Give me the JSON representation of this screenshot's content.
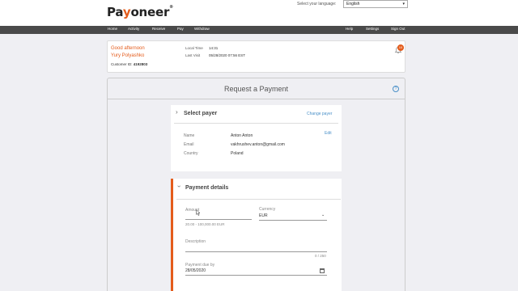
{
  "header": {
    "logo_pre": "Pa",
    "logo_y": "y",
    "logo_post": "oneer",
    "logo_tm": "®",
    "language_label": "Select your language:",
    "language_value": "English"
  },
  "nav": {
    "items": [
      "Home",
      "Activity",
      "Receive",
      "Pay",
      "Withdraw"
    ],
    "right_items": [
      "Help",
      "Settings",
      "Sign Out"
    ]
  },
  "welcome": {
    "greeting": "Good afternoon",
    "name": "Yury Polyashko",
    "customer_label": "Customer ID:",
    "customer_id": "4192803",
    "local_time_label": "Local Time",
    "local_time": "14:31",
    "last_visit_label": "Last Visit",
    "last_visit": "05/28/2020 07:56 EST",
    "notification_count": "10"
  },
  "request": {
    "title": "Request a Payment",
    "help_icon": "?"
  },
  "payer": {
    "title": "Select payer",
    "change_link": "Change payer",
    "edit_link": "Edit",
    "fields": [
      {
        "label": "Name",
        "value": "Anton Anton"
      },
      {
        "label": "Email",
        "value": "vakhrushev.anton@gmail.com"
      },
      {
        "label": "Country",
        "value": "Poland"
      }
    ]
  },
  "payment": {
    "title": "Payment details",
    "amount_label": "Amount",
    "amount_value": "",
    "amount_hint": "20.00 - 100,000.00 EUR",
    "currency_label": "Currency",
    "currency_value": "EUR",
    "description_label": "Description",
    "description_counter": "0 / 250",
    "due_label": "Payment due by",
    "due_value": "28/05/2020"
  },
  "colors": {
    "accent": "#e45c1c",
    "link": "#4a90c8",
    "nav_bg": "#4a4a4a"
  }
}
